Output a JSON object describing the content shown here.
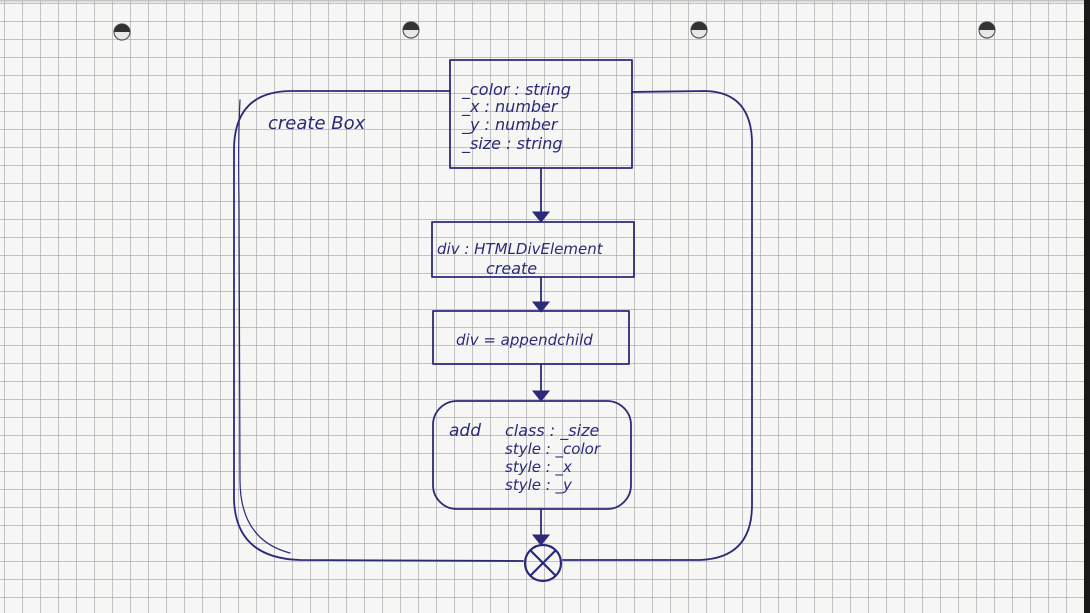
{
  "diagram": {
    "container_label": "create Box",
    "attributes_box": {
      "lines": [
        "_color : string",
        "_x : number",
        "_y : number",
        "_size : string"
      ]
    },
    "create_box": {
      "line1": "div : HTMLDivElement",
      "line2": "create"
    },
    "append_box": {
      "text": "div = appendchild"
    },
    "add_box": {
      "prefix": "add",
      "lines": [
        "class : _size",
        "style : _color",
        "style : _x",
        "style : _y"
      ]
    },
    "end_node": "final-node"
  },
  "colors": {
    "ink": "#2b2a7a",
    "paper": "#f6f6f4",
    "grid": "#9696a0"
  }
}
